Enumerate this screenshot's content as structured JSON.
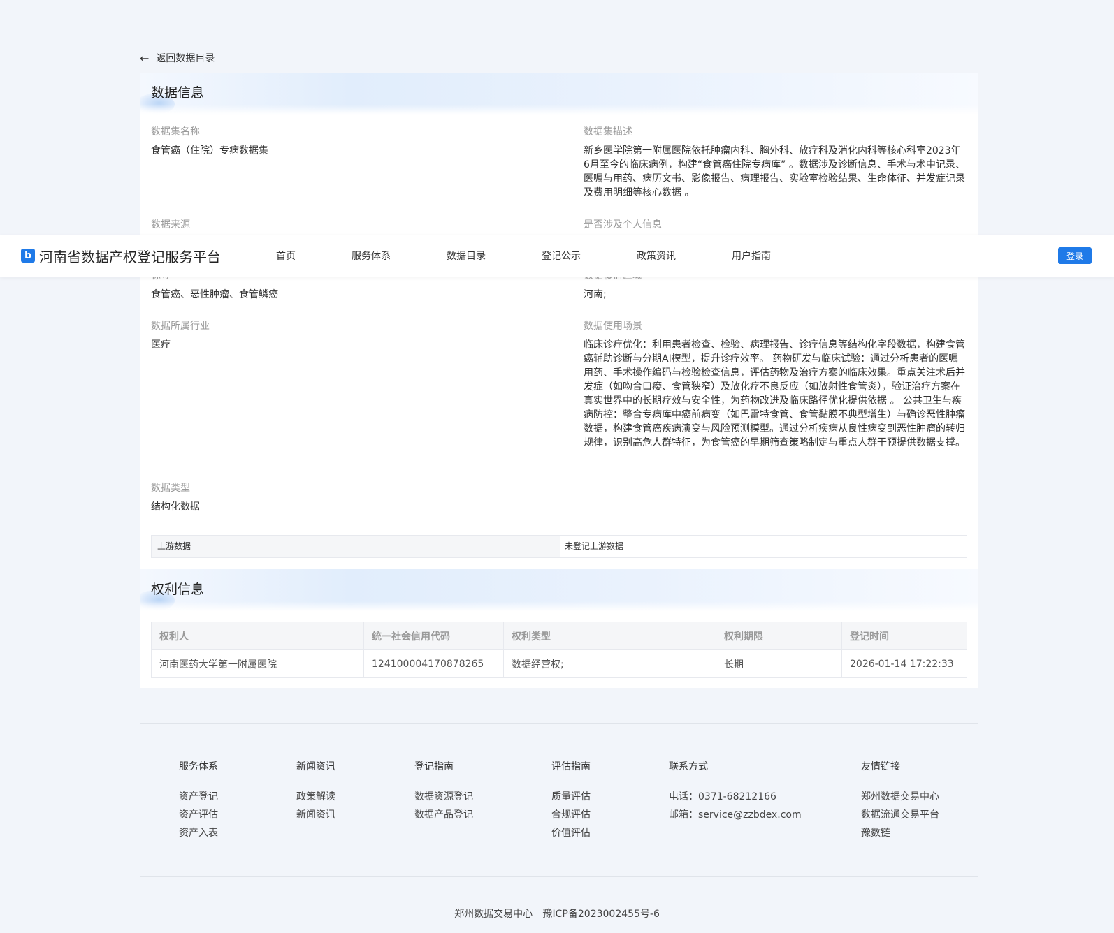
{
  "back_link": "返回数据目录",
  "data_info": {
    "section_title": "数据信息",
    "dataset_name_label": "数据集名称",
    "dataset_name": "食管癌（住院）专病数据集",
    "description_label": "数据集描述",
    "description": "新乡医学院第一附属医院依托肿瘤内科、胸外科、放疗科及消化内科等核心科室2023年6月至今的临床病例，构建“食管癌住院专病库” 。数据涉及诊断信息、手术与术中记录、医嘱与用药、病历文书、影像报告、病理报告、实验室检验结果、生命体征、并发症记录及费用明细等核心数据 。",
    "source_label": "数据来源",
    "personal_info_label": "是否涉及个人信息",
    "tags_label": "标签",
    "tags": "食管癌、恶性肿瘤、食管鳞癌",
    "coverage_label": "数据覆盖区域",
    "coverage": "河南;",
    "industry_label": "数据所属行业",
    "industry": "医疗",
    "scenario_label": "数据使用场景",
    "scenario": "临床诊疗优化：利用患者检查、检验、病理报告、诊疗信息等结构化字段数据，构建食管癌辅助诊断与分期AI模型，提升诊疗效率。 药物研发与临床试验：通过分析患者的医嘱用药、手术操作编码与检验检查信息，评估药物及治疗方案的临床效果。重点关注术后并发症（如吻合口瘘、食管狭窄）及放化疗不良反应（如放射性食管炎），验证治疗方案在真实世界中的长期疗效与安全性，为药物改进及临床路径优化提供依据 。 公共卫生与疾病防控：整合专病库中癌前病变（如巴雷特食管、食管黏膜不典型增生）与确诊恶性肿瘤数据，构建食管癌疾病演变与风险预测模型。通过分析疾病从良性病变到恶性肿瘤的转归规律，识别高危人群特征，为食管癌的早期筛查策略制定与重点人群干预提供数据支撑。",
    "type_label": "数据类型",
    "type": "结构化数据",
    "upstream_label": "上游数据",
    "upstream_value": "未登记上游数据"
  },
  "rights_info": {
    "section_title": "权利信息",
    "headers": [
      "权利人",
      "统一社会信用代码",
      "权利类型",
      "权利期限",
      "登记时间"
    ],
    "row": [
      "河南医药大学第一附属医院",
      "124100004170878265",
      "数据经营权;",
      "长期",
      "2026-01-14 17:22:33"
    ]
  },
  "navbar": {
    "logo_glyph": "b",
    "brand": "河南省数据产权登记服务平台",
    "items": [
      "首页",
      "服务体系",
      "数据目录",
      "登记公示",
      "政策资讯",
      "用户指南"
    ],
    "login": "登录",
    "accent": "#1f7ae8"
  },
  "footer": {
    "service": {
      "title": "服务体系",
      "links": [
        "资产登记",
        "资产评估",
        "资产入表"
      ]
    },
    "news": {
      "title": "新闻资讯",
      "links": [
        "政策解读",
        "新闻资讯"
      ]
    },
    "register": {
      "title": "登记指南",
      "links": [
        "数据资源登记",
        "数据产品登记"
      ]
    },
    "evaluate": {
      "title": "评估指南",
      "links": [
        "质量评估",
        "合规评估",
        "价值评估"
      ]
    },
    "contact": {
      "title": "联系方式",
      "phone": "电话：0371-68212166",
      "email": "邮箱：service@zzbdex.com"
    },
    "friends": {
      "title": "友情链接",
      "links": [
        "郑州数据交易中心",
        "数据流通交易平台",
        "豫数链"
      ]
    },
    "copyright_org": "郑州数据交易中心",
    "icp": "豫ICP备2023002455号-6"
  }
}
